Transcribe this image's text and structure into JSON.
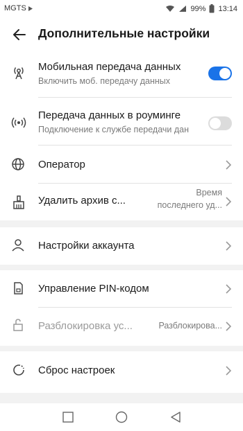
{
  "status": {
    "carrier": "MGTS",
    "battery": "99%",
    "time": "13:14"
  },
  "header": {
    "title": "Дополнительные настройки"
  },
  "rows": {
    "mobile_data": {
      "title": "Мобильная передача данных",
      "subtitle": "Включить моб. передачу данных",
      "toggle_on": true
    },
    "roaming": {
      "title": "Передача данных в роуминге",
      "subtitle": "Подключение к службе передачи дан",
      "toggle_on": false
    },
    "operator": {
      "title": "Оператор"
    },
    "clear_archive": {
      "title": "Удалить архив с...",
      "value_line1": "Время",
      "value_line2": "последнего уд..."
    },
    "account_settings": {
      "title": "Настройки аккаунта"
    },
    "pin_management": {
      "title": "Управление PIN-кодом"
    },
    "unlock": {
      "title": "Разблокировка ус...",
      "value": "Разблокирова..."
    },
    "reset": {
      "title": "Сброс настроек"
    }
  },
  "colors": {
    "accent": "#1a73e8",
    "toggle_off": "#dcdcdc",
    "background": "#f2f2f2"
  },
  "icons": {
    "back": "back-arrow-icon",
    "mobile_data": "antenna-icon",
    "roaming": "roaming-signal-icon",
    "operator": "globe-icon",
    "clear_archive": "broom-icon",
    "account": "person-icon",
    "pin": "sim-card-icon",
    "unlock": "unlock-icon",
    "reset": "reset-icon"
  }
}
